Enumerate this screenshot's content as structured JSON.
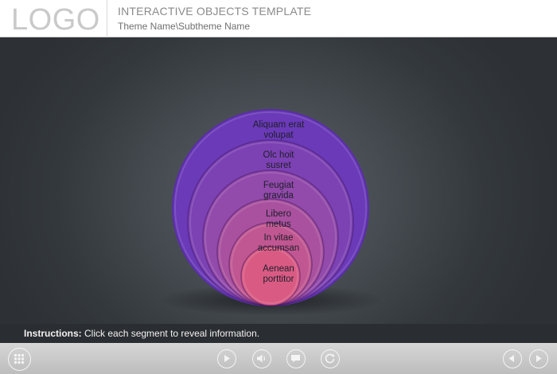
{
  "header": {
    "logo": "LOGO",
    "title": "INTERACTIVE OBJECTS TEMPLATE",
    "subtitle": "Theme Name\\Subtheme Name"
  },
  "segments": [
    {
      "line1": "Aliquam erat",
      "line2": "volupat",
      "color": "#6a3ab8"
    },
    {
      "line1": "Olc hoit",
      "line2": "susret",
      "color": "#7c41b3"
    },
    {
      "line1": "Feugiat",
      "line2": "gravida",
      "color": "#924aab"
    },
    {
      "line1": "Libero",
      "line2": "metus",
      "color": "#a9519f"
    },
    {
      "line1": "In vitae",
      "line2": "accumsan",
      "color": "#c15792"
    },
    {
      "line1": "Aenean",
      "line2": "porttitor",
      "color": "#d95b84"
    }
  ],
  "instructions": {
    "label": "Instructions:",
    "text": "Click each segment to reveal information."
  },
  "controls": {
    "menu_icon": "grid-icon",
    "play_icon": "play-icon",
    "audio_icon": "speaker-icon",
    "captions_icon": "caption-icon",
    "replay_icon": "replay-icon",
    "prev_icon": "prev-icon",
    "next_icon": "next-icon"
  }
}
